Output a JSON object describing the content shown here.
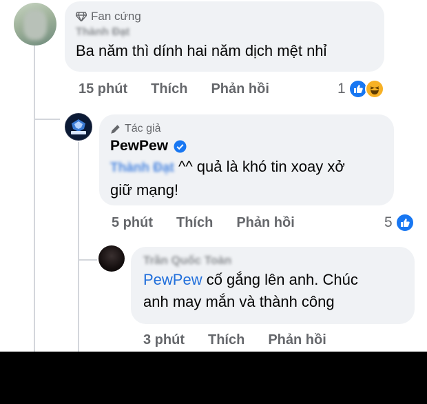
{
  "colors": {
    "background": "#ffffff",
    "bubble": "#f0f2f5",
    "secondary_text": "#65676b",
    "mention": "#216fdb",
    "verified": "#1877f2",
    "like": "#1877f2",
    "haha": "#f7b125",
    "footer": "#000000"
  },
  "comment1": {
    "badge_icon": "diamond-icon",
    "badge": "Fan cứng",
    "name_blurred": "Thành Đạt",
    "text": "Ba năm thì dính hai năm dịch mệt nhỉ",
    "time": "15 phút",
    "like": "Thích",
    "reply": "Phản hồi",
    "reaction_count": "1",
    "reaction_icons": [
      "like-icon",
      "haha-icon"
    ]
  },
  "comment2": {
    "badge_icon": "pencil-icon",
    "badge": "Tác giả",
    "author": "PewPew",
    "verified_icon": "verified-icon",
    "mention_blurred": "Thành Đạt",
    "text_line1": " ^^ quả là khó tin xoay xở",
    "text_line2": "giữ mạng!",
    "time": "5 phút",
    "like": "Thích",
    "reply": "Phản hồi",
    "reaction_count": "5",
    "reaction_icons": [
      "like-icon"
    ]
  },
  "comment3": {
    "name_blurred": "Trần Quốc Toàn",
    "mention": "PewPew",
    "text_line1": " cố gắng lên anh. Chúc",
    "text_line2": "anh may mắn và thành công",
    "time": "3 phút",
    "like": "Thích",
    "reply": "Phản hồi"
  }
}
